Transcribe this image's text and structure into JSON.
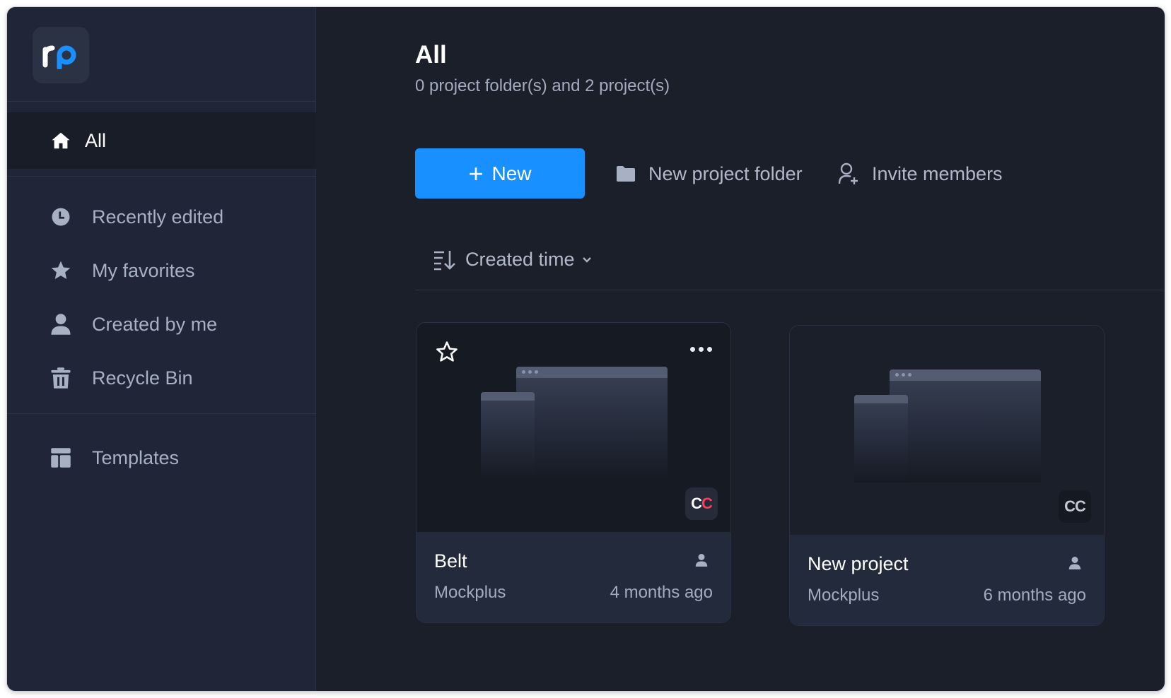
{
  "sidebar": {
    "logo_text": "rp",
    "active_item": {
      "label": "All",
      "icon": "home-icon"
    },
    "items": [
      {
        "label": "Recently edited",
        "icon": "clock-icon"
      },
      {
        "label": "My favorites",
        "icon": "star-icon"
      },
      {
        "label": "Created by me",
        "icon": "user-icon"
      },
      {
        "label": "Recycle Bin",
        "icon": "trash-icon"
      }
    ],
    "templates": {
      "label": "Templates",
      "icon": "template-icon"
    }
  },
  "main": {
    "title": "All",
    "subtitle": "0 project folder(s) and 2 project(s)",
    "new_button": {
      "plus": "+",
      "label": "New"
    },
    "new_folder_label": "New project folder",
    "invite_label": "Invite members",
    "sort_label": "Created time"
  },
  "projects": [
    {
      "name": "Belt",
      "team": "Mockplus",
      "updated": "4 months ago",
      "badge": "CC"
    },
    {
      "name": "New project",
      "team": "Mockplus",
      "updated": "6 months ago",
      "badge": "CC"
    }
  ],
  "colors": {
    "accent": "#1890ff",
    "window_bg": "#1b1f2a",
    "sidebar_bg": "#202637",
    "card_footer_bg": "#232a3b",
    "badge_red": "#ff3b5c"
  }
}
